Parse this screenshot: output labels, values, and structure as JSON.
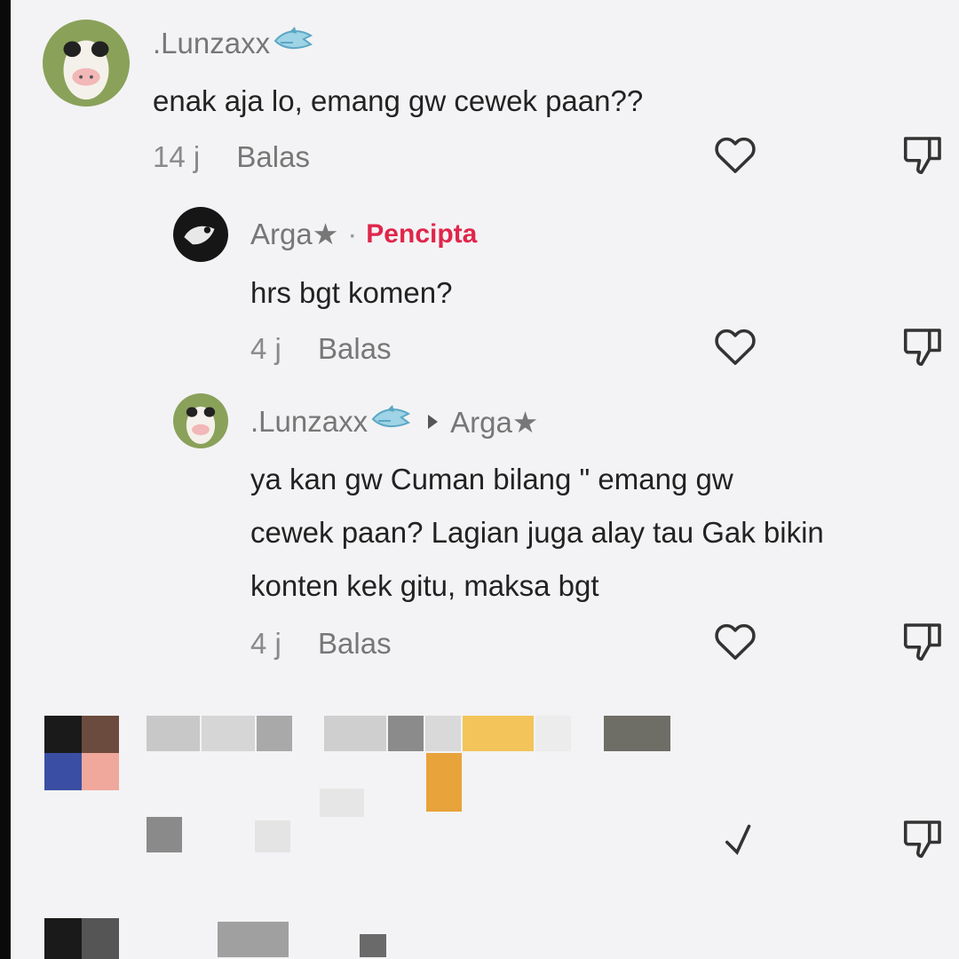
{
  "comments": [
    {
      "username": ".Lunzaxx",
      "text_lines": [
        "enak aja lo, emang gw cewek paan??"
      ],
      "time": "14 j",
      "reply_label": "Balas"
    },
    {
      "username": "Arga★",
      "separator": "·",
      "creator_badge": "Pencipta",
      "text_lines": [
        "hrs bgt komen?"
      ],
      "time": "4 j",
      "reply_label": "Balas"
    },
    {
      "username": ".Lunzaxx",
      "reply_to": "Arga★",
      "text_lines": [
        "ya kan gw Cuman bilang \" emang gw",
        "cewek paan? Lagian juga alay tau Gak bikin",
        "konten kek gitu, maksa bgt"
      ],
      "time": "4 j",
      "reply_label": "Balas"
    }
  ],
  "icons": {
    "like": "heart-outline-icon",
    "dislike": "thumbs-down-outline-icon",
    "username_emoji": "shark-emoji-icon"
  },
  "colors": {
    "creator_badge": "#e0264b",
    "background": "#f3f3f5"
  }
}
